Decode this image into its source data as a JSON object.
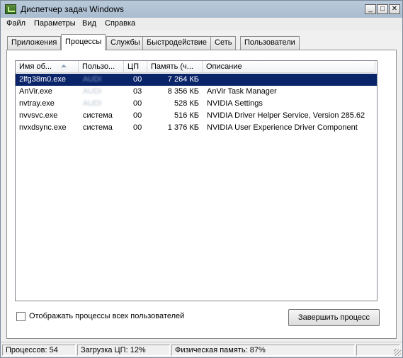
{
  "window": {
    "title": "Диспетчер задач Windows",
    "controls": {
      "minimize": "_",
      "maximize": "□",
      "close": "✕"
    }
  },
  "menu": [
    "Файл",
    "Параметры",
    "Вид",
    "Справка"
  ],
  "tabs": [
    {
      "label": "Приложения",
      "active": false
    },
    {
      "label": "Процессы",
      "active": true
    },
    {
      "label": "Службы",
      "active": false
    },
    {
      "label": "Быстродействие",
      "active": false
    },
    {
      "label": "Сеть",
      "active": false
    },
    {
      "label": "Пользователи",
      "active": false
    }
  ],
  "columns": [
    "Имя об...",
    "Пользо...",
    "ЦП",
    "Память (ч...",
    "Описание"
  ],
  "processes": [
    {
      "name": "2lfg38m0.exe",
      "user": "AUDI",
      "cpu": "00",
      "memory": "7 264 КБ",
      "description": "",
      "selected": true
    },
    {
      "name": "AnVir.exe",
      "user": "AUDI",
      "cpu": "03",
      "memory": "8 356 КБ",
      "description": "AnVir Task Manager",
      "selected": false
    },
    {
      "name": "nvtray.exe",
      "user": "AUDI",
      "cpu": "00",
      "memory": "528 КБ",
      "description": "NVIDIA Settings",
      "selected": false
    },
    {
      "name": "nvvsvc.exe",
      "user": "система",
      "cpu": "00",
      "memory": "516 КБ",
      "description": "NVIDIA Driver Helper Service, Version 285.62",
      "selected": false
    },
    {
      "name": "nvxdsync.exe",
      "user": "система",
      "cpu": "00",
      "memory": "1 376 КБ",
      "description": "NVIDIA User Experience Driver Component",
      "selected": false
    }
  ],
  "show_all_checkbox": {
    "label": "Отображать процессы всех пользователей",
    "checked": false
  },
  "end_process_button": "Завершить процесс",
  "status": {
    "processes": "Процессов: 54",
    "cpu": "Загрузка ЦП: 12%",
    "memory": "Физическая память: 87%"
  },
  "colors": {
    "selection": "#0a246a",
    "title_bar": "#b0c2d4"
  }
}
